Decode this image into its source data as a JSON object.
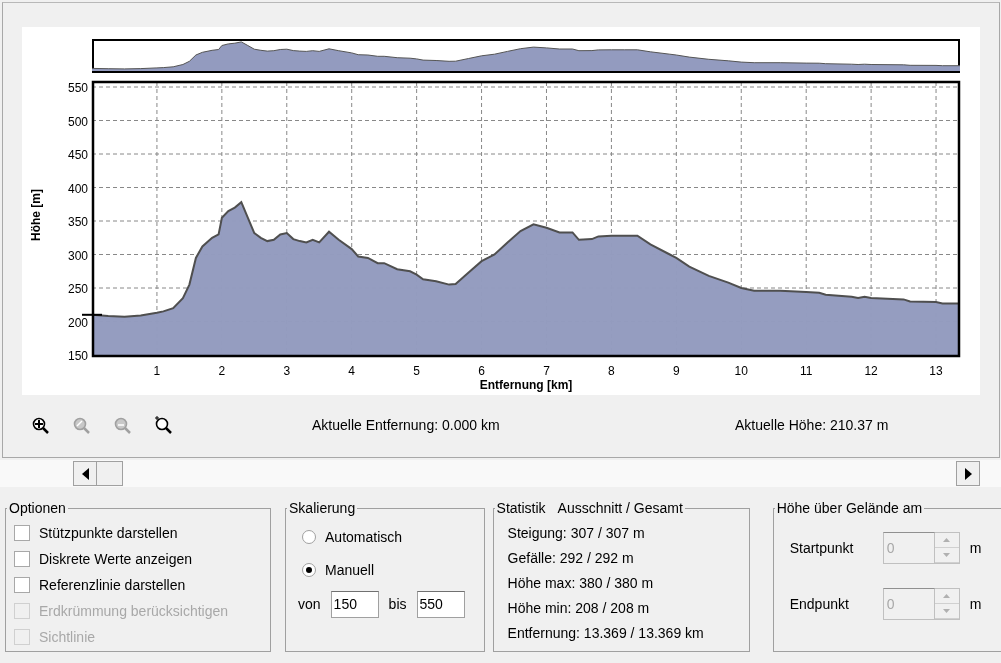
{
  "profile": {
    "chart_data": {
      "type": "area",
      "xlabel": "Entfernung [km]",
      "ylabel": "Höhe [m]",
      "x": [
        0,
        0.25,
        0.5,
        0.75,
        1,
        1.1,
        1.25,
        1.4,
        1.5,
        1.6,
        1.7,
        1.85,
        1.95,
        2,
        2.1,
        2.2,
        2.3,
        2.4,
        2.5,
        2.6,
        2.7,
        2.8,
        2.9,
        3,
        3.1,
        3.2,
        3.3,
        3.4,
        3.5,
        3.65,
        3.8,
        4,
        4.1,
        4.25,
        4.4,
        4.5,
        4.7,
        4.9,
        5,
        5.1,
        5.3,
        5.5,
        5.6,
        5.8,
        6,
        6.2,
        6.4,
        6.6,
        6.8,
        7,
        7.2,
        7.4,
        7.5,
        7.7,
        7.8,
        8,
        8.2,
        8.4,
        8.6,
        8.9,
        9,
        9.2,
        9.5,
        9.8,
        10,
        10.2,
        10.6,
        11,
        11.2,
        11.3,
        11.7,
        11.8,
        11.9,
        12,
        12.5,
        12.6,
        13,
        13.1,
        13.369
      ],
      "values": [
        210,
        208,
        207,
        209,
        213,
        215,
        220,
        235,
        255,
        295,
        312,
        325,
        330,
        355,
        365,
        370,
        378,
        355,
        332,
        325,
        320,
        322,
        330,
        332,
        323,
        320,
        318,
        322,
        318,
        334,
        322,
        308,
        297,
        295,
        287,
        287,
        278,
        275,
        270,
        263,
        260,
        255,
        256,
        273,
        290,
        300,
        318,
        335,
        345,
        340,
        333,
        333,
        322,
        323,
        327,
        328,
        328,
        328,
        315,
        300,
        295,
        282,
        268,
        258,
        250,
        246,
        246,
        244,
        243,
        240,
        237,
        235,
        237,
        235,
        233,
        230,
        229,
        227,
        227
      ],
      "xlim": [
        0,
        13.369
      ],
      "ylim": [
        150,
        550
      ],
      "xticks": [
        1,
        2,
        3,
        4,
        5,
        6,
        7,
        8,
        9,
        10,
        11,
        12,
        13
      ],
      "yticks": [
        150,
        200,
        250,
        300,
        350,
        400,
        450,
        500,
        550
      ],
      "grid": true
    }
  },
  "toolbar": [
    {
      "kind": "zoom-in",
      "disabled": false
    },
    {
      "kind": "zoom-area",
      "disabled": true
    },
    {
      "kind": "zoom-out",
      "disabled": true
    },
    {
      "kind": "zoom-reset",
      "disabled": false
    }
  ],
  "readouts": {
    "distance": "Aktuelle Entfernung: 0.000 km",
    "height": "Aktuelle Höhe: 210.37 m"
  },
  "options": {
    "title": "Optionen",
    "items": [
      {
        "label": "Stützpunkte darstellen",
        "checked": false,
        "disabled": false
      },
      {
        "label": "Diskrete Werte anzeigen",
        "checked": false,
        "disabled": false
      },
      {
        "label": "Referenzlinie darstellen",
        "checked": false,
        "disabled": false
      },
      {
        "label": "Erdkrümmung berücksichtigen",
        "checked": false,
        "disabled": true
      },
      {
        "label": "Sichtlinie",
        "checked": false,
        "disabled": true
      }
    ]
  },
  "scaling": {
    "title": "Skalierung",
    "radios": [
      {
        "label": "Automatisch",
        "selected": false
      },
      {
        "label": "Manuell",
        "selected": true
      }
    ],
    "from_label": "von",
    "from_value": "150",
    "to_label": "bis",
    "to_value": "550"
  },
  "statistics": {
    "title": "Statistik",
    "subtitle": "Ausschnitt / Gesamt",
    "lines": [
      "Steigung: 307 / 307 m",
      "Gefälle: 292 / 292 m",
      "Höhe max: 380 / 380 m",
      "Höhe min: 208 / 208 m",
      "Entfernung: 13.369 / 13.369 km"
    ]
  },
  "height_above": {
    "title": "Höhe über Gelände am",
    "fields": [
      {
        "label": "Startpunkt",
        "value": "0",
        "unit": "m",
        "disabled": true
      },
      {
        "label": "Endpunkt",
        "value": "0",
        "unit": "m",
        "disabled": true
      }
    ]
  }
}
